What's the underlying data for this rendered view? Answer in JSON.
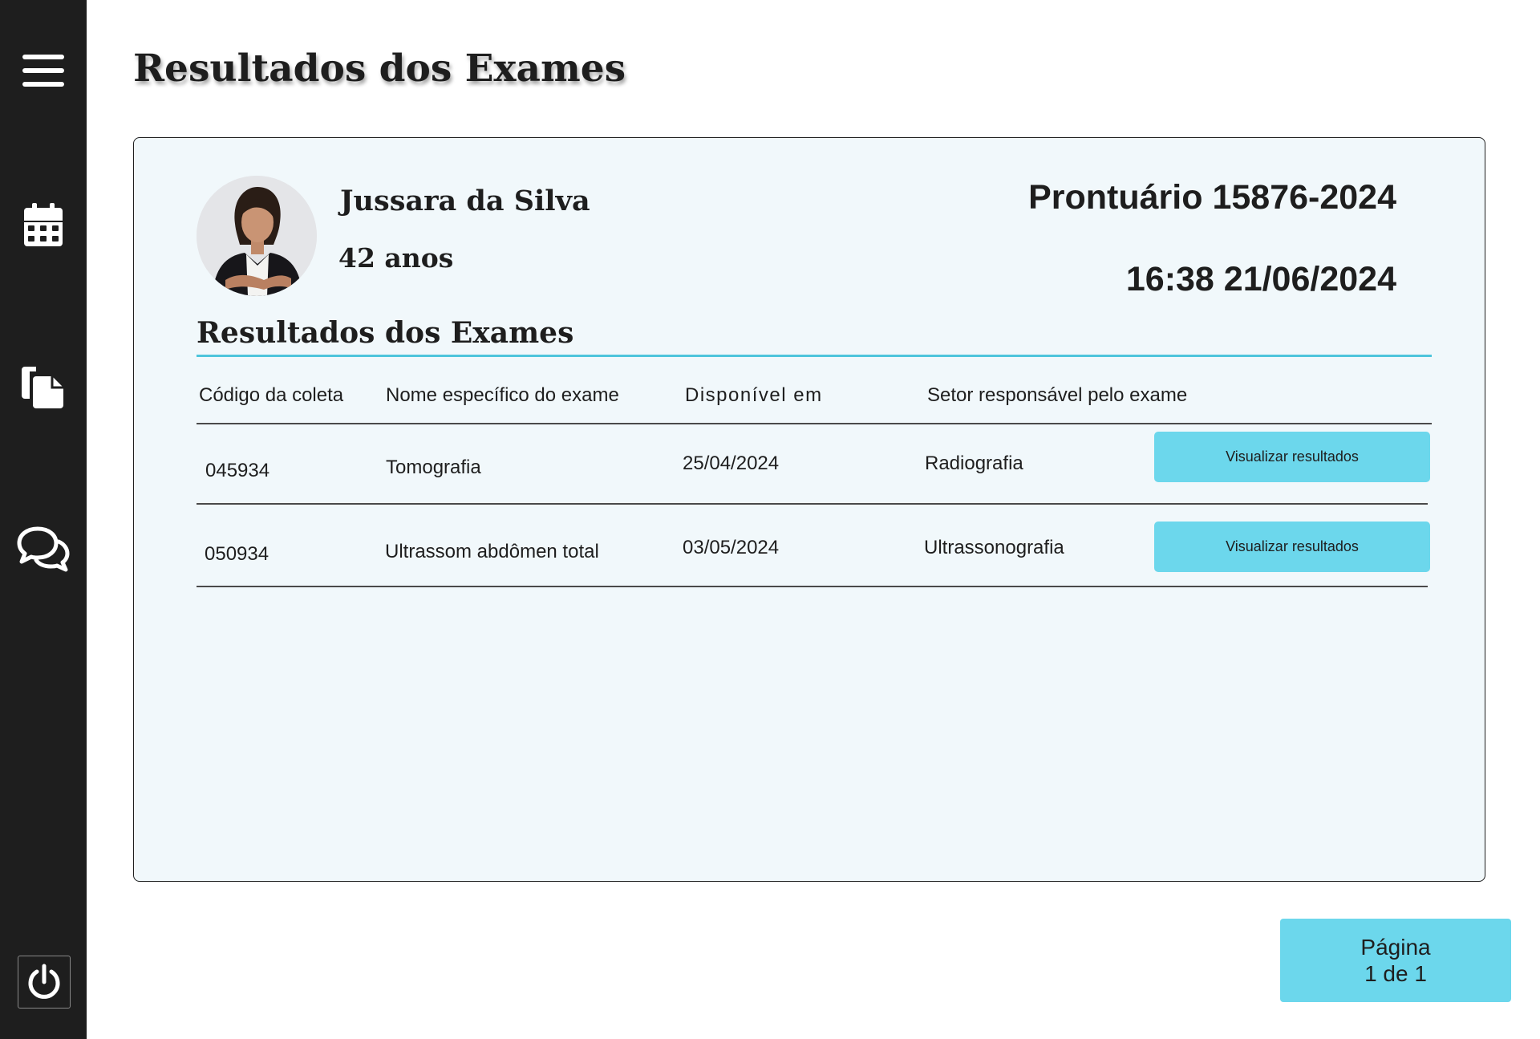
{
  "page": {
    "title": "Resultados dos Exames"
  },
  "sidebar": {
    "items": [
      {
        "icon": "menu-icon"
      },
      {
        "icon": "calendar-icon"
      },
      {
        "icon": "clipboard-copy-icon"
      },
      {
        "icon": "chat-icon"
      },
      {
        "icon": "power-icon"
      }
    ]
  },
  "patient": {
    "name": "Jussara da Silva",
    "age": "42 anos",
    "record": "Prontuário 15876-2024",
    "datetime": "16:38 21/06/2024"
  },
  "section": {
    "title": "Resultados dos Exames"
  },
  "table": {
    "headers": [
      "Código da coleta",
      "Nome específico do exame",
      "Disponível em",
      "Setor responsável pelo exame"
    ],
    "rows": [
      {
        "code": "045934",
        "exam": "Tomografia",
        "available": "25/04/2024",
        "sector": "Radiografia",
        "action": "Visualizar resultados"
      },
      {
        "code": "050934",
        "exam": "Ultrassom abdômen total",
        "available": "03/05/2024",
        "sector": "Ultrassonografia",
        "action": "Visualizar resultados"
      }
    ]
  },
  "pagination": {
    "label": "Página",
    "value": "1 de 1"
  },
  "colors": {
    "sidebar": "#1e1e1e",
    "accent": "#6cd7ec",
    "card_bg": "#f1f8fb",
    "rule": "#4ec5dc"
  }
}
